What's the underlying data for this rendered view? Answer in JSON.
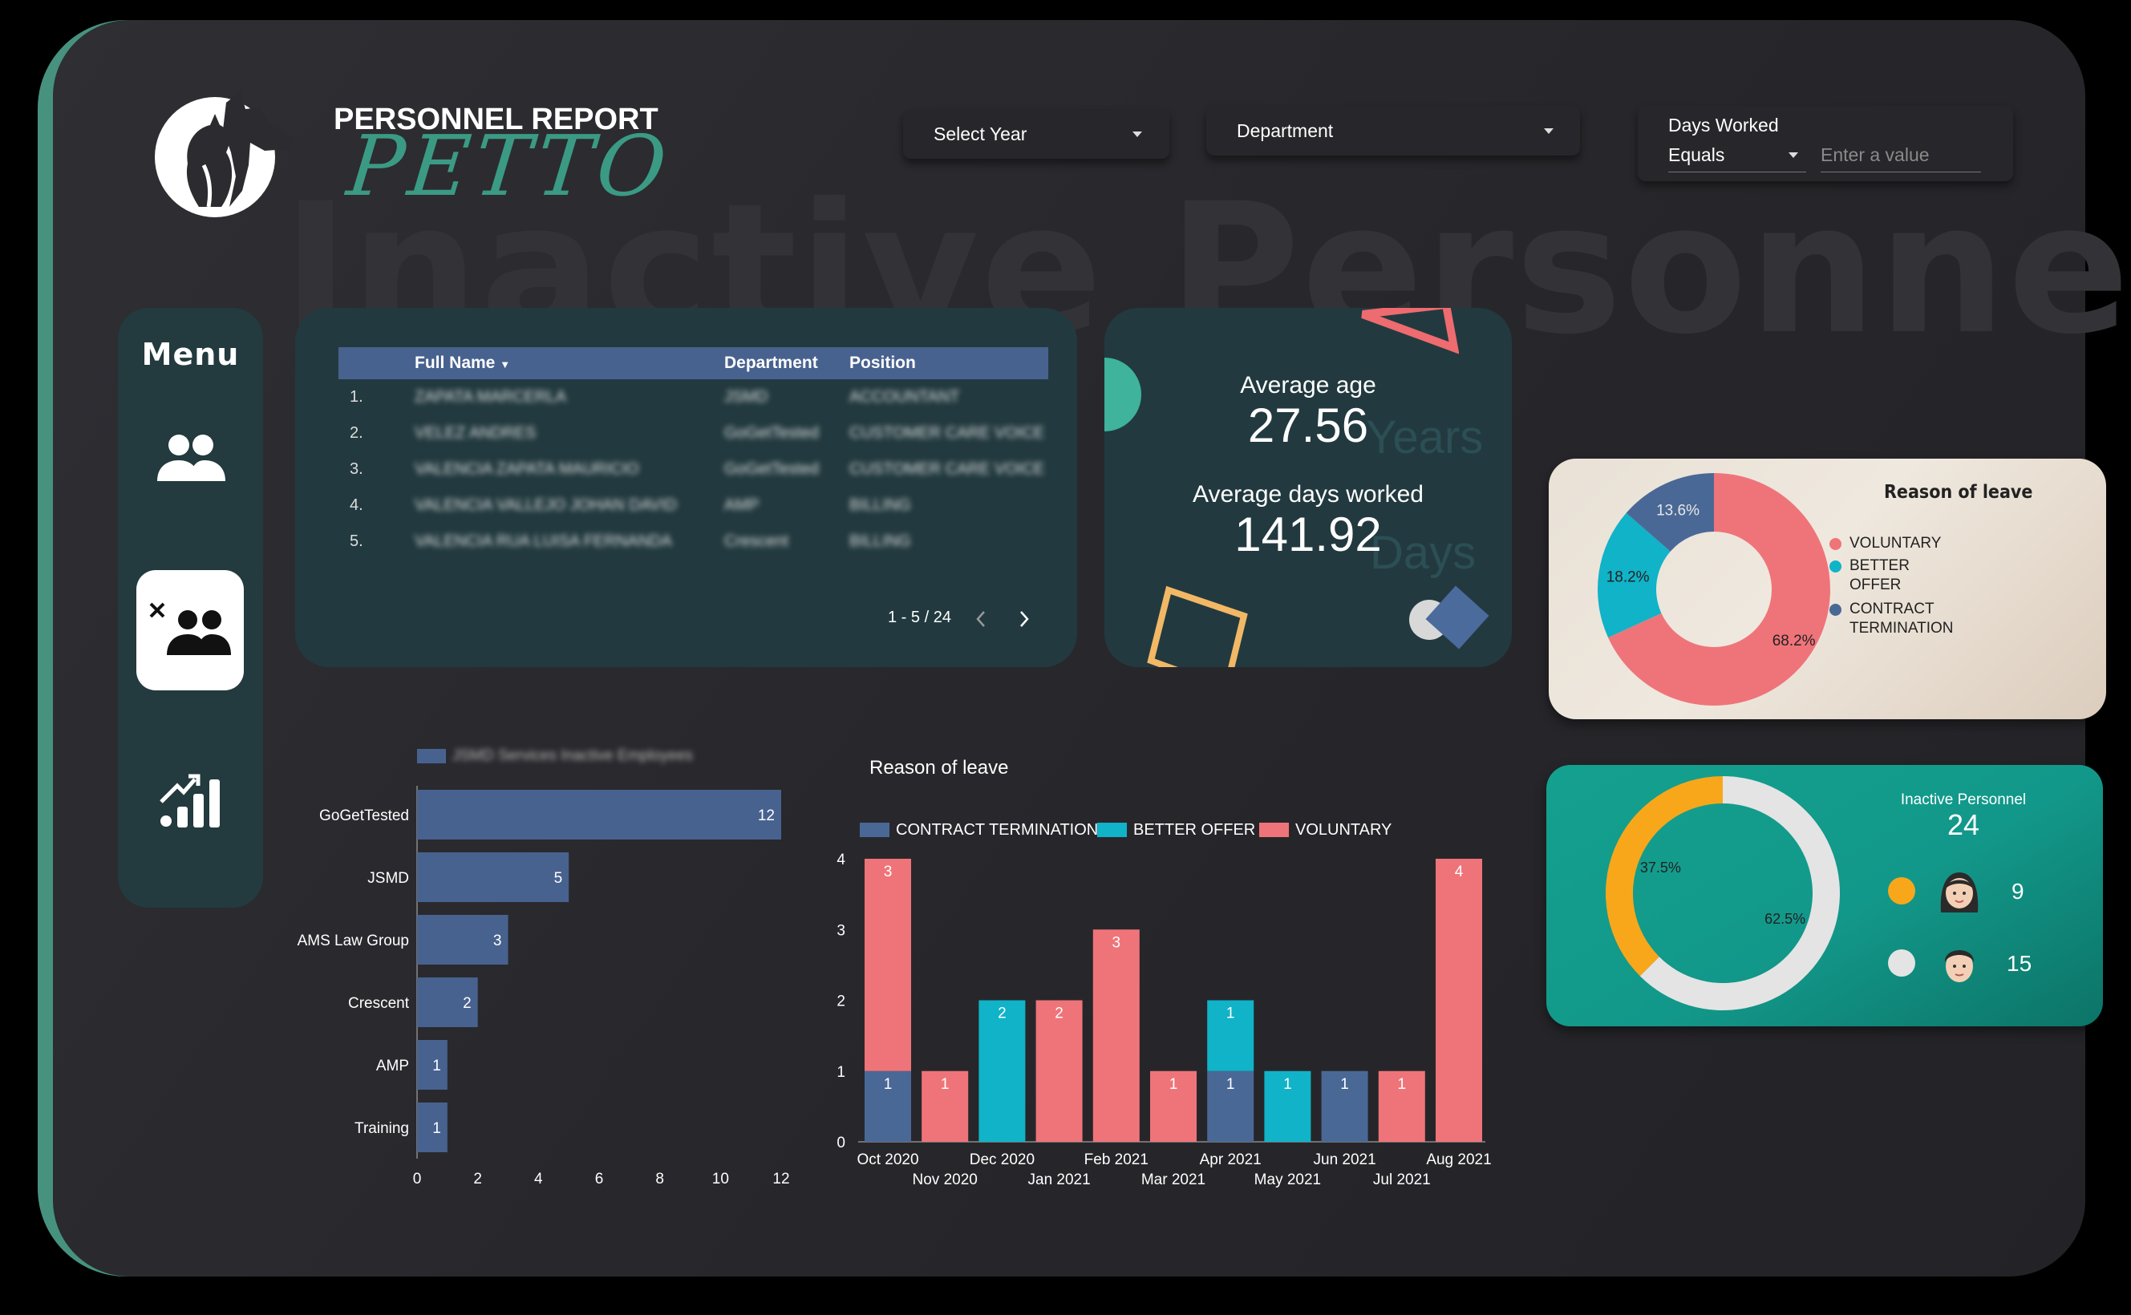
{
  "brand": {
    "title": "PERSONNEL REPORT",
    "name": "PETTO"
  },
  "page_title": "Inactive Personnel",
  "filters": {
    "year_label": "Select Year",
    "department_label": "Department",
    "days_worked": {
      "label": "Days Worked",
      "operator": "Equals",
      "placeholder": "Enter a value"
    }
  },
  "menu": {
    "title": "Menu",
    "items": [
      {
        "icon": "people-icon",
        "active": false
      },
      {
        "icon": "inactive-people-icon",
        "active": true
      },
      {
        "icon": "analytics-icon",
        "active": false
      }
    ]
  },
  "table": {
    "columns": [
      "Full Name",
      "Department",
      "Position"
    ],
    "rows": [
      {
        "idx": "1.",
        "name": "ZAPATA MARCERLA",
        "dept": "JSMD",
        "position": "ACCOUNTANT"
      },
      {
        "idx": "2.",
        "name": "VELEZ ANDRES",
        "dept": "GoGetTested",
        "position": "CUSTOMER CARE VOICE"
      },
      {
        "idx": "3.",
        "name": "VALENCIA ZAPATA MAURICIO",
        "dept": "GoGetTested",
        "position": "CUSTOMER CARE VOICE"
      },
      {
        "idx": "4.",
        "name": "VALENCIA VALLEJO JOHAN DAVID",
        "dept": "AMP",
        "position": "BILLING"
      },
      {
        "idx": "5.",
        "name": "VALENCIA RUA LUISA FERNANDA",
        "dept": "Crescent",
        "position": "BILLING"
      }
    ],
    "pagination": "1 - 5 / 24"
  },
  "stats": {
    "avg_age_label": "Average age",
    "avg_age": "27.56",
    "avg_age_unit": "Years",
    "avg_days_label": "Average days worked",
    "avg_days": "141.92",
    "avg_days_unit": "Days"
  },
  "colors": {
    "voluntary": "#ef7479",
    "better_offer": "#10b3c8",
    "contract_termination": "#4a6896",
    "bar": "#48628f",
    "female": "#f8a71b",
    "male": "#e4e4e4"
  },
  "chart_data": [
    {
      "type": "pie",
      "title": "Reason of leave",
      "categories": [
        "VOLUNTARY",
        "BETTER OFFER",
        "CONTRACT TERMINATION"
      ],
      "values": [
        68.2,
        18.2,
        13.6
      ],
      "labels": [
        "68.2%",
        "18.2%",
        "13.6%"
      ]
    },
    {
      "type": "pie",
      "title": "Inactive Personnel",
      "total": "24",
      "categories": [
        "female",
        "male"
      ],
      "values": [
        9,
        15
      ],
      "labels": [
        "37.5%",
        "62.5%"
      ]
    },
    {
      "type": "bar",
      "orientation": "horizontal",
      "legend": "JSMD Services Inactive Employees",
      "categories": [
        "GoGetTested",
        "JSMD",
        "AMS Law Group",
        "Crescent",
        "AMP",
        "Training"
      ],
      "values": [
        12,
        5,
        3,
        2,
        1,
        1
      ],
      "xlim": [
        0,
        12
      ],
      "xticks": [
        "0",
        "2",
        "4",
        "6",
        "8",
        "10",
        "12"
      ]
    },
    {
      "type": "bar",
      "stacked": true,
      "title": "Reason of leave",
      "categories": [
        "Oct 2020",
        "Nov 2020",
        "Dec 2020",
        "Jan 2021",
        "Feb 2021",
        "Mar 2021",
        "Apr 2021",
        "May 2021",
        "Jun 2021",
        "Jul 2021",
        "Aug 2021"
      ],
      "series": [
        {
          "name": "CONTRACT TERMINATION",
          "values": [
            1,
            0,
            0,
            0,
            0,
            0,
            1,
            0,
            1,
            0,
            0
          ]
        },
        {
          "name": "BETTER OFFER",
          "values": [
            0,
            0,
            2,
            0,
            0,
            0,
            1,
            1,
            0,
            0,
            0
          ]
        },
        {
          "name": "VOLUNTARY",
          "values": [
            3,
            1,
            0,
            2,
            3,
            1,
            0,
            0,
            0,
            1,
            4
          ]
        }
      ],
      "ylim": [
        0,
        4
      ],
      "yticks": [
        "0",
        "1",
        "2",
        "3",
        "4"
      ]
    }
  ]
}
